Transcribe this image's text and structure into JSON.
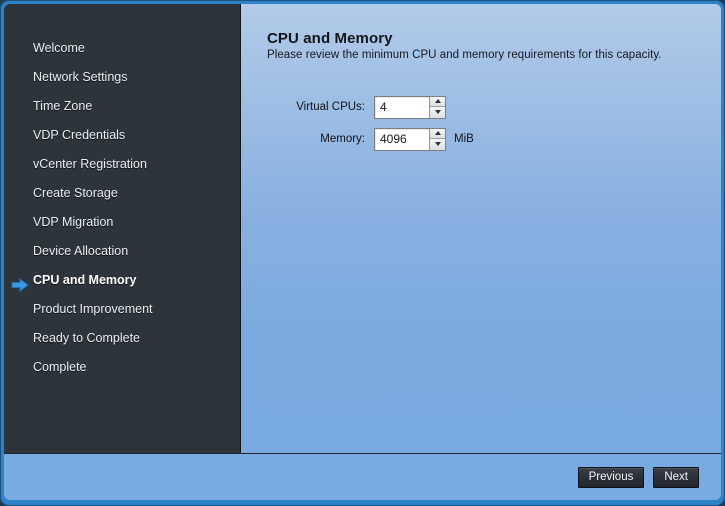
{
  "window": {
    "frame_color": "#2c83c9",
    "outer_background": "#1d3c58"
  },
  "sidebar": {
    "background": "#2e343b",
    "active_index": 8,
    "active_arrow_icon": "arrow-right-icon",
    "items": [
      {
        "label": "Welcome",
        "active": false
      },
      {
        "label": "Network Settings",
        "active": false
      },
      {
        "label": "Time Zone",
        "active": false
      },
      {
        "label": "VDP Credentials",
        "active": false
      },
      {
        "label": "vCenter Registration",
        "active": false
      },
      {
        "label": "Create Storage",
        "active": false
      },
      {
        "label": "VDP Migration",
        "active": false
      },
      {
        "label": "Device Allocation",
        "active": false
      },
      {
        "label": "CPU and Memory",
        "active": true
      },
      {
        "label": "Product Improvement",
        "active": false
      },
      {
        "label": "Ready to Complete",
        "active": false
      },
      {
        "label": "Complete",
        "active": false
      }
    ]
  },
  "main": {
    "title": "CPU and Memory",
    "subtitle": "Please review the minimum CPU and memory requirements for this capacity.",
    "accent_color": "#7cafe4",
    "form": {
      "fields": [
        {
          "label": "Virtual CPUs:",
          "value": "4",
          "placeholder": "",
          "unit": "",
          "spinner_up_icon": "triangle-up-icon",
          "spinner_down_icon": "triangle-down-icon"
        },
        {
          "label": "Memory:",
          "value": "4096",
          "placeholder": "",
          "unit": "MiB",
          "spinner_up_icon": "triangle-up-icon",
          "spinner_down_icon": "triangle-down-icon"
        }
      ]
    }
  },
  "footer": {
    "previous_label": "Previous",
    "next_label": "Next"
  }
}
